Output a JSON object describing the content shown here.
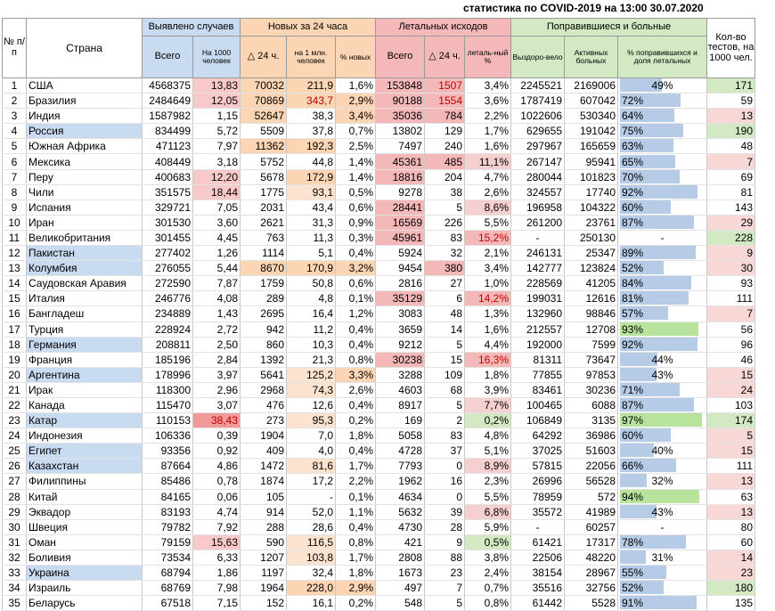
{
  "title": "статистика по COVID-2019 на 13:00 30.07.2020",
  "headers": {
    "no": "№ п/п",
    "country": "Страна",
    "detected": "Выявлено случаев",
    "new24": "Новых за 24 часа",
    "lethal": "Летальных исходов",
    "recovered": "Поправившиеся и больные",
    "tests": "Кол-во тестов, на 1000 чел.",
    "total": "Всего",
    "per1000": "На 1000 человек",
    "d24": "△ 24 ч.",
    "per1m": "на 1 млн. человек",
    "pct_new": "% новых",
    "lethal_total": "Всего",
    "lethal_d24": "△ 24 ч.",
    "lethal_pct": "леталь-ный %",
    "recov": "Выздоро-вело",
    "active": "Активных больных",
    "share": "% поправившихся и доля летальных"
  },
  "colors": {
    "blue": "#c9dbf0",
    "orange": "#fcd5b4",
    "red": "#f4b8b8",
    "green": "#d3e9c3",
    "bar_blue": "#b6cbe6",
    "bar_green": "#b7e39d"
  },
  "rows": [
    {
      "n": "1",
      "country": "США",
      "total": "4568375",
      "per1000": "13,83",
      "d24": "70032",
      "per1m": "211,9",
      "pct_new": "1,6%",
      "lethal": "153848",
      "lethal_d24": "1507",
      "lethal_pct": "3,4%",
      "recovered": "2245521",
      "active": "2169006",
      "share": "49%",
      "share_v": 49,
      "tests": "171"
    },
    {
      "n": "2",
      "country": "Бразилия",
      "total": "2484649",
      "per1000": "12,05",
      "d24": "70869",
      "per1m": "343,7",
      "pct_new": "2,9%",
      "lethal": "90188",
      "lethal_d24": "1554",
      "lethal_pct": "3,6%",
      "recovered": "1787419",
      "active": "607042",
      "share": "72%",
      "share_v": 72,
      "tests": "59"
    },
    {
      "n": "3",
      "country": "Индия",
      "total": "1587982",
      "per1000": "1,15",
      "d24": "52647",
      "per1m": "38,3",
      "pct_new": "3,4%",
      "lethal": "35036",
      "lethal_d24": "784",
      "lethal_pct": "2,2%",
      "recovered": "1022606",
      "active": "530340",
      "share": "64%",
      "share_v": 64,
      "tests": "13"
    },
    {
      "n": "4",
      "country": "Россия",
      "total": "834499",
      "per1000": "5,72",
      "d24": "5509",
      "per1m": "37,8",
      "pct_new": "0,7%",
      "lethal": "13802",
      "lethal_d24": "129",
      "lethal_pct": "1,7%",
      "recovered": "629655",
      "active": "191042",
      "share": "75%",
      "share_v": 75,
      "tests": "190"
    },
    {
      "n": "5",
      "country": "Южная Африка",
      "total": "471123",
      "per1000": "7,97",
      "d24": "11362",
      "per1m": "192,3",
      "pct_new": "2,5%",
      "lethal": "7497",
      "lethal_d24": "240",
      "lethal_pct": "1,6%",
      "recovered": "297967",
      "active": "165659",
      "share": "63%",
      "share_v": 63,
      "tests": "48"
    },
    {
      "n": "6",
      "country": "Мексика",
      "total": "408449",
      "per1000": "3,18",
      "d24": "5752",
      "per1m": "44,8",
      "pct_new": "1,4%",
      "lethal": "45361",
      "lethal_d24": "485",
      "lethal_pct": "11,1%",
      "recovered": "267147",
      "active": "95941",
      "share": "65%",
      "share_v": 65,
      "tests": "7"
    },
    {
      "n": "7",
      "country": "Перу",
      "total": "400683",
      "per1000": "12,20",
      "d24": "5678",
      "per1m": "172,9",
      "pct_new": "1,4%",
      "lethal": "18816",
      "lethal_d24": "204",
      "lethal_pct": "4,7%",
      "recovered": "280044",
      "active": "101823",
      "share": "70%",
      "share_v": 70,
      "tests": "69"
    },
    {
      "n": "8",
      "country": "Чили",
      "total": "351575",
      "per1000": "18,44",
      "d24": "1775",
      "per1m": "93,1",
      "pct_new": "0,5%",
      "lethal": "9278",
      "lethal_d24": "38",
      "lethal_pct": "2,6%",
      "recovered": "324557",
      "active": "17740",
      "share": "92%",
      "share_v": 92,
      "tests": "81"
    },
    {
      "n": "9",
      "country": "Испания",
      "total": "329721",
      "per1000": "7,05",
      "d24": "2031",
      "per1m": "43,4",
      "pct_new": "0,6%",
      "lethal": "28441",
      "lethal_d24": "5",
      "lethal_pct": "8,6%",
      "recovered": "196958",
      "active": "104322",
      "share": "60%",
      "share_v": 60,
      "tests": "143"
    },
    {
      "n": "10",
      "country": "Иран",
      "total": "301530",
      "per1000": "3,60",
      "d24": "2621",
      "per1m": "31,3",
      "pct_new": "0,9%",
      "lethal": "16569",
      "lethal_d24": "226",
      "lethal_pct": "5,5%",
      "recovered": "261200",
      "active": "23761",
      "share": "87%",
      "share_v": 87,
      "tests": "29"
    },
    {
      "n": "11",
      "country": "Великобритания",
      "total": "301455",
      "per1000": "4,45",
      "d24": "763",
      "per1m": "11,3",
      "pct_new": "0,3%",
      "lethal": "45961",
      "lethal_d24": "83",
      "lethal_pct": "15,2%",
      "recovered": "-",
      "active": "250130",
      "share": "-",
      "share_v": 0,
      "tests": "228"
    },
    {
      "n": "12",
      "country": "Пакистан",
      "total": "277402",
      "per1000": "1,26",
      "d24": "1114",
      "per1m": "5,1",
      "pct_new": "0,4%",
      "lethal": "5924",
      "lethal_d24": "32",
      "lethal_pct": "2,1%",
      "recovered": "246131",
      "active": "25347",
      "share": "89%",
      "share_v": 89,
      "tests": "9"
    },
    {
      "n": "13",
      "country": "Колумбия",
      "total": "276055",
      "per1000": "5,44",
      "d24": "8670",
      "per1m": "170,9",
      "pct_new": "3,2%",
      "lethal": "9454",
      "lethal_d24": "380",
      "lethal_pct": "3,4%",
      "recovered": "142777",
      "active": "123824",
      "share": "52%",
      "share_v": 52,
      "tests": "30"
    },
    {
      "n": "14",
      "country": "Саудовская Аравия",
      "total": "272590",
      "per1000": "7,87",
      "d24": "1759",
      "per1m": "50,8",
      "pct_new": "0,6%",
      "lethal": "2816",
      "lethal_d24": "27",
      "lethal_pct": "1,0%",
      "recovered": "228569",
      "active": "41205",
      "share": "84%",
      "share_v": 84,
      "tests": "93"
    },
    {
      "n": "15",
      "country": "Италия",
      "total": "246776",
      "per1000": "4,08",
      "d24": "289",
      "per1m": "4,8",
      "pct_new": "0,1%",
      "lethal": "35129",
      "lethal_d24": "6",
      "lethal_pct": "14,2%",
      "recovered": "199031",
      "active": "12616",
      "share": "81%",
      "share_v": 81,
      "tests": "111"
    },
    {
      "n": "16",
      "country": "Бангладеш",
      "total": "234889",
      "per1000": "1,43",
      "d24": "2695",
      "per1m": "16,4",
      "pct_new": "1,2%",
      "lethal": "3083",
      "lethal_d24": "48",
      "lethal_pct": "1,3%",
      "recovered": "132960",
      "active": "98846",
      "share": "57%",
      "share_v": 57,
      "tests": "7"
    },
    {
      "n": "17",
      "country": "Турция",
      "total": "228924",
      "per1000": "2,72",
      "d24": "942",
      "per1m": "11,2",
      "pct_new": "0,4%",
      "lethal": "3659",
      "lethal_d24": "14",
      "lethal_pct": "1,6%",
      "recovered": "212557",
      "active": "12708",
      "share": "93%",
      "share_v": 93,
      "tests": "56"
    },
    {
      "n": "18",
      "country": "Германия",
      "total": "208811",
      "per1000": "2,50",
      "d24": "860",
      "per1m": "10,3",
      "pct_new": "0,4%",
      "lethal": "9212",
      "lethal_d24": "5",
      "lethal_pct": "4,4%",
      "recovered": "192000",
      "active": "7599",
      "share": "92%",
      "share_v": 92,
      "tests": "96"
    },
    {
      "n": "19",
      "country": "Франция",
      "total": "185196",
      "per1000": "2,84",
      "d24": "1392",
      "per1m": "21,3",
      "pct_new": "0,8%",
      "lethal": "30238",
      "lethal_d24": "15",
      "lethal_pct": "16,3%",
      "recovered": "81311",
      "active": "73647",
      "share": "44%",
      "share_v": 44,
      "tests": "46"
    },
    {
      "n": "20",
      "country": "Аргентина",
      "total": "178996",
      "per1000": "3,97",
      "d24": "5641",
      "per1m": "125,2",
      "pct_new": "3,3%",
      "lethal": "3288",
      "lethal_d24": "109",
      "lethal_pct": "1,8%",
      "recovered": "77855",
      "active": "97853",
      "share": "43%",
      "share_v": 43,
      "tests": "15"
    },
    {
      "n": "21",
      "country": "Ирак",
      "total": "118300",
      "per1000": "2,96",
      "d24": "2968",
      "per1m": "74,3",
      "pct_new": "2,6%",
      "lethal": "4603",
      "lethal_d24": "68",
      "lethal_pct": "3,9%",
      "recovered": "83461",
      "active": "30236",
      "share": "71%",
      "share_v": 71,
      "tests": "24"
    },
    {
      "n": "22",
      "country": "Канада",
      "total": "115470",
      "per1000": "3,07",
      "d24": "476",
      "per1m": "12,6",
      "pct_new": "0,4%",
      "lethal": "8917",
      "lethal_d24": "5",
      "lethal_pct": "7,7%",
      "recovered": "100465",
      "active": "6088",
      "share": "87%",
      "share_v": 87,
      "tests": "103"
    },
    {
      "n": "23",
      "country": "Катар",
      "total": "110153",
      "per1000": "38,43",
      "d24": "273",
      "per1m": "95,3",
      "pct_new": "0,2%",
      "lethal": "169",
      "lethal_d24": "2",
      "lethal_pct": "0,2%",
      "recovered": "106849",
      "active": "3135",
      "share": "97%",
      "share_v": 97,
      "tests": "174"
    },
    {
      "n": "24",
      "country": "Индонезия",
      "total": "106336",
      "per1000": "0,39",
      "d24": "1904",
      "per1m": "7,0",
      "pct_new": "1,8%",
      "lethal": "5058",
      "lethal_d24": "83",
      "lethal_pct": "4,8%",
      "recovered": "64292",
      "active": "36986",
      "share": "60%",
      "share_v": 60,
      "tests": "5"
    },
    {
      "n": "25",
      "country": "Египет",
      "total": "93356",
      "per1000": "0,92",
      "d24": "409",
      "per1m": "4,0",
      "pct_new": "0,4%",
      "lethal": "4728",
      "lethal_d24": "37",
      "lethal_pct": "5,1%",
      "recovered": "37025",
      "active": "51603",
      "share": "40%",
      "share_v": 40,
      "tests": "15"
    },
    {
      "n": "26",
      "country": "Казахстан",
      "total": "87664",
      "per1000": "4,86",
      "d24": "1472",
      "per1m": "81,6",
      "pct_new": "1,7%",
      "lethal": "7793",
      "lethal_d24": "0",
      "lethal_pct": "8,9%",
      "recovered": "57815",
      "active": "22056",
      "share": "66%",
      "share_v": 66,
      "tests": "111"
    },
    {
      "n": "27",
      "country": "Филиппины",
      "total": "85486",
      "per1000": "0,78",
      "d24": "1874",
      "per1m": "17,2",
      "pct_new": "2,2%",
      "lethal": "1962",
      "lethal_d24": "16",
      "lethal_pct": "2,3%",
      "recovered": "26996",
      "active": "56528",
      "share": "32%",
      "share_v": 32,
      "tests": "13"
    },
    {
      "n": "28",
      "country": "Китай",
      "total": "84165",
      "per1000": "0,06",
      "d24": "105",
      "per1m": "-",
      "pct_new": "0,1%",
      "lethal": "4634",
      "lethal_d24": "0",
      "lethal_pct": "5,5%",
      "recovered": "78959",
      "active": "572",
      "share": "94%",
      "share_v": 94,
      "tests": "63"
    },
    {
      "n": "29",
      "country": "Эквадор",
      "total": "83193",
      "per1000": "4,74",
      "d24": "914",
      "per1m": "52,0",
      "pct_new": "1,1%",
      "lethal": "5632",
      "lethal_d24": "39",
      "lethal_pct": "6,8%",
      "recovered": "35572",
      "active": "41989",
      "share": "43%",
      "share_v": 43,
      "tests": "13"
    },
    {
      "n": "30",
      "country": "Швеция",
      "total": "79782",
      "per1000": "7,92",
      "d24": "288",
      "per1m": "28,6",
      "pct_new": "0,4%",
      "lethal": "4730",
      "lethal_d24": "28",
      "lethal_pct": "5,9%",
      "recovered": "-",
      "active": "60257",
      "share": "-",
      "share_v": 0,
      "tests": "80"
    },
    {
      "n": "31",
      "country": "Оман",
      "total": "79159",
      "per1000": "15,63",
      "d24": "590",
      "per1m": "116,5",
      "pct_new": "0,8%",
      "lethal": "421",
      "lethal_d24": "9",
      "lethal_pct": "0,5%",
      "recovered": "61421",
      "active": "17317",
      "share": "78%",
      "share_v": 78,
      "tests": "60"
    },
    {
      "n": "32",
      "country": "Боливия",
      "total": "73534",
      "per1000": "6,33",
      "d24": "1207",
      "per1m": "103,8",
      "pct_new": "1,7%",
      "lethal": "2808",
      "lethal_d24": "88",
      "lethal_pct": "3,8%",
      "recovered": "22506",
      "active": "48220",
      "share": "31%",
      "share_v": 31,
      "tests": "14"
    },
    {
      "n": "33",
      "country": "Украина",
      "total": "68794",
      "per1000": "1,86",
      "d24": "1197",
      "per1m": "32,4",
      "pct_new": "1,8%",
      "lethal": "1673",
      "lethal_d24": "23",
      "lethal_pct": "2,4%",
      "recovered": "38154",
      "active": "28967",
      "share": "55%",
      "share_v": 55,
      "tests": "23"
    },
    {
      "n": "34",
      "country": "Израиль",
      "total": "68769",
      "per1000": "7,98",
      "d24": "1964",
      "per1m": "228,0",
      "pct_new": "2,9%",
      "lethal": "497",
      "lethal_d24": "7",
      "lethal_pct": "0,7%",
      "recovered": "35516",
      "active": "32756",
      "share": "52%",
      "share_v": 52,
      "tests": "180"
    },
    {
      "n": "35",
      "country": "Беларусь",
      "total": "67518",
      "per1000": "7,15",
      "d24": "152",
      "per1m": "16,1",
      "pct_new": "0,2%",
      "lethal": "548",
      "lethal_d24": "5",
      "lethal_pct": "0,8%",
      "recovered": "61442",
      "active": "5528",
      "share": "91%",
      "share_v": 91,
      "tests": "135"
    }
  ]
}
